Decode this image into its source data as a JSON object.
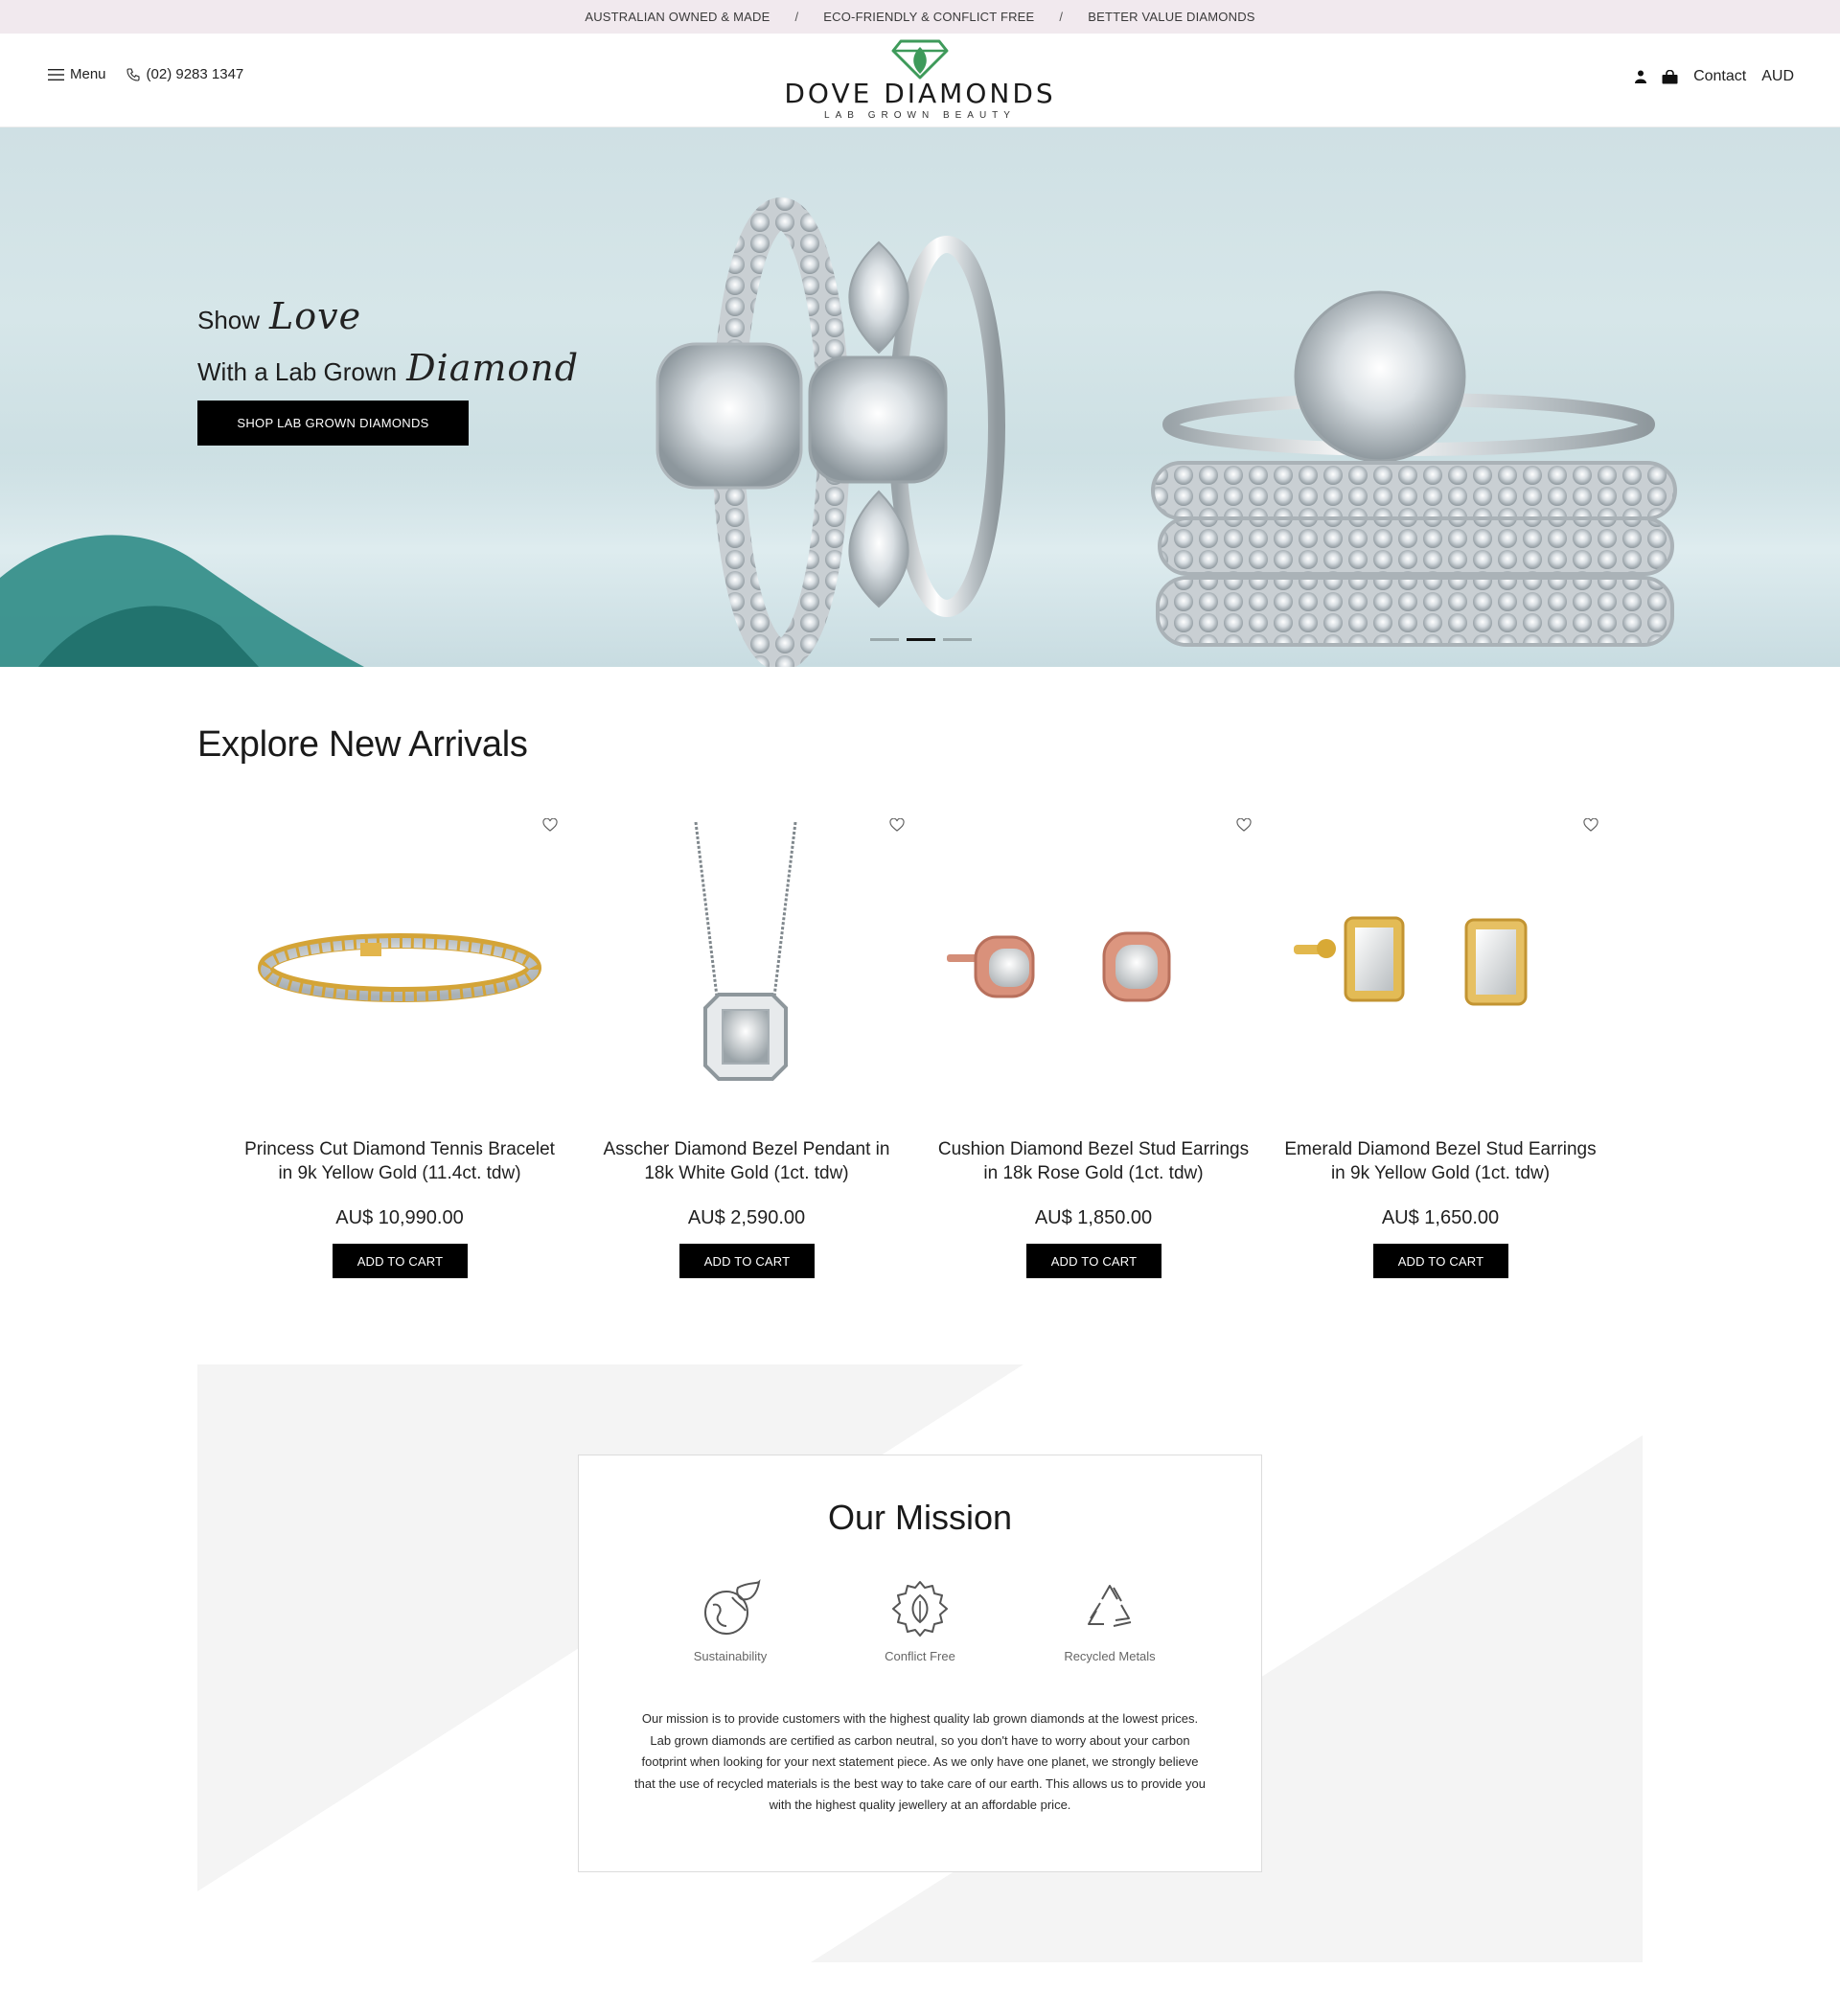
{
  "announcement": {
    "items": [
      "AUSTRALIAN OWNED & MADE",
      "ECO-FRIENDLY & CONFLICT FREE",
      "BETTER VALUE DIAMONDS"
    ],
    "separator": "/"
  },
  "header": {
    "menu_label": "Menu",
    "phone": "(02) 9283 1347",
    "brand": "DOVE DIAMONDS",
    "tagline": "LAB GROWN BEAUTY",
    "contact_label": "Contact",
    "currency": "AUD",
    "icons": [
      "menu-icon",
      "phone-icon",
      "account-icon",
      "bag-icon"
    ]
  },
  "hero": {
    "line1_plain": "Show",
    "line1_script": "Love",
    "line2_plain": "With a Lab Grown",
    "line2_script": "Diamond",
    "cta": "SHOP LAB GROWN DIAMONDS",
    "slides_count": 3,
    "active_slide": 2
  },
  "arrivals": {
    "title": "Explore New Arrivals",
    "products": [
      {
        "name": "Princess Cut Diamond Tennis Bracelet in 9k Yellow Gold (11.4ct. tdw)",
        "price": "AU$ 10,990.00",
        "cta": "ADD TO CART"
      },
      {
        "name": "Asscher Diamond Bezel Pendant in 18k White Gold (1ct. tdw)",
        "price": "AU$ 2,590.00",
        "cta": "ADD TO CART"
      },
      {
        "name": "Cushion Diamond Bezel Stud Earrings in 18k Rose Gold (1ct. tdw)",
        "price": "AU$ 1,850.00",
        "cta": "ADD TO CART"
      },
      {
        "name": "Emerald Diamond Bezel Stud Earrings in 9k Yellow Gold (1ct. tdw)",
        "price": "AU$ 1,650.00",
        "cta": "ADD TO CART"
      }
    ]
  },
  "mission": {
    "title": "Our Mission",
    "pillars": [
      "Sustainability",
      "Conflict Free",
      "Recycled Metals"
    ],
    "text": "Our mission is to provide customers with the highest quality lab grown diamonds at the lowest prices. Lab grown diamonds are certified as carbon neutral, so you don't have to worry about your carbon footprint when looking for your next statement piece. As we only have one planet, we strongly believe that the use of recycled materials is the best way to take care of our earth. This allows us to provide you with the highest quality jewellery at an affordable price."
  },
  "colors": {
    "announce_bg": "#f1e9ee",
    "button_bg": "#000000",
    "logo_green": "#3e9a5a",
    "hero_bg": "#cfe0e4"
  }
}
